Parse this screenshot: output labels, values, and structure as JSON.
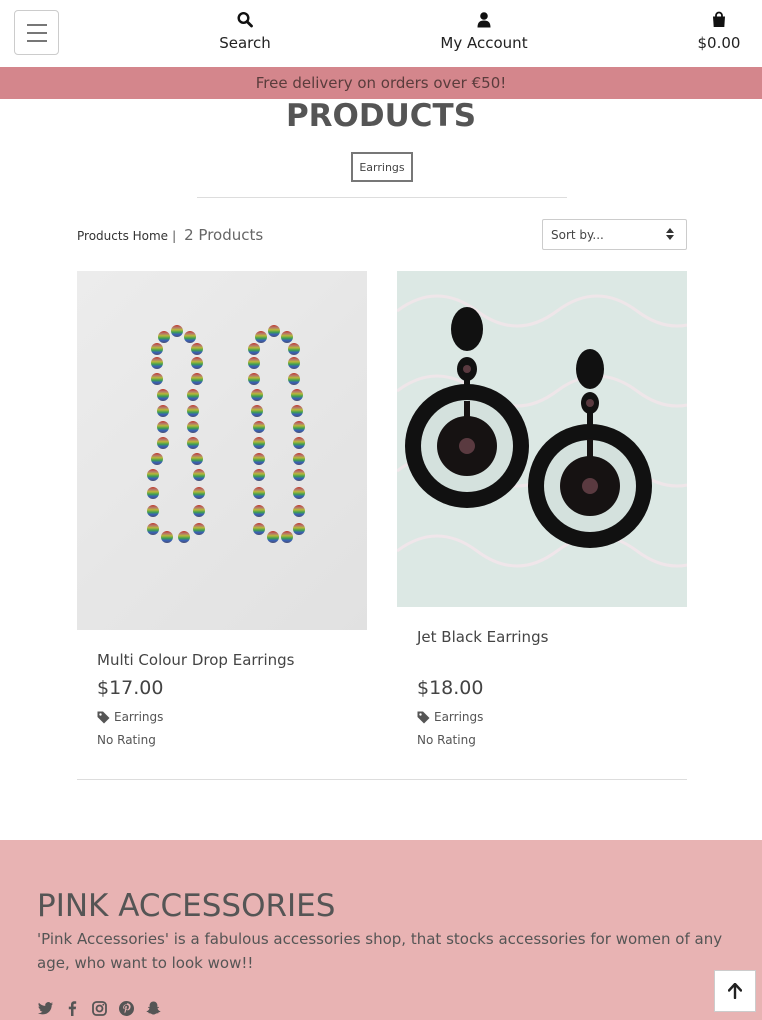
{
  "nav": {
    "search_label": "Search",
    "account_label": "My Account",
    "bag_total": "$0.00"
  },
  "promo": "Free delivery on orders over €50!",
  "page_title": "PRODUCTS",
  "category_chip": "Earrings",
  "breadcrumb": {
    "home": "Products Home",
    "separator": "|",
    "count": "2 Products"
  },
  "sort": {
    "selected": "Sort by..."
  },
  "products": [
    {
      "name": "Multi Colour Drop Earrings",
      "price": "$17.00",
      "category": "Earrings",
      "rating": "No Rating"
    },
    {
      "name": "Jet Black Earrings",
      "price": "$18.00",
      "category": "Earrings",
      "rating": "No Rating"
    }
  ],
  "footer": {
    "title": "PINK ACCESSORIES",
    "description": "'Pink Accessories' is a fabulous accessories shop, that stocks accessories for women of any age, who want to look wow!!",
    "social_icons": [
      "twitter-icon",
      "facebook-icon",
      "instagram-icon",
      "pinterest-icon",
      "snapchat-icon"
    ]
  },
  "colors": {
    "promo_bg": "#d4868c",
    "footer_bg": "#e8b3b3"
  }
}
